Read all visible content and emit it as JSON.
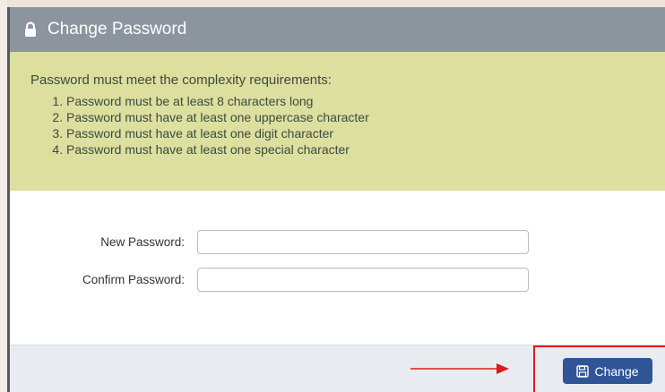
{
  "dialog": {
    "title": "Change Password",
    "title_icon": "lock-icon"
  },
  "requirements": {
    "heading": "Password must meet the complexity requirements:",
    "items": [
      "Password must be at least 8 characters long",
      "Password must have at least one uppercase character",
      "Password must have at least one digit character",
      "Password must have at least one special character"
    ]
  },
  "form": {
    "new_password_label": "New Password:",
    "new_password_value": "",
    "confirm_password_label": "Confirm Password:",
    "confirm_password_value": ""
  },
  "footer": {
    "change_label": "Change",
    "change_icon": "save-icon"
  },
  "colors": {
    "titlebar": "#8c959e",
    "requirements_bg": "#dcdf9d",
    "button": "#2f5597",
    "annotation": "#e0191a"
  }
}
